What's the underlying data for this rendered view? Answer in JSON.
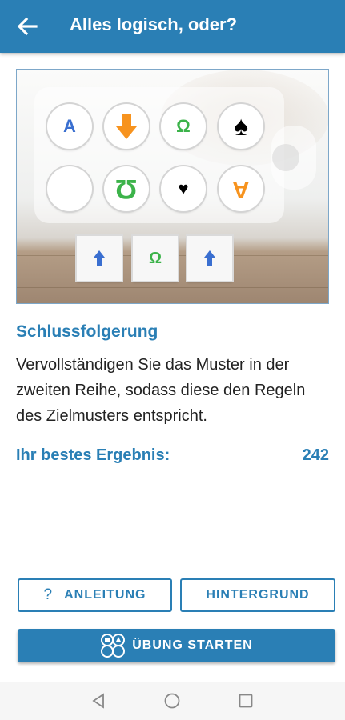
{
  "appbar": {
    "title": "Alles logisch, oder?",
    "back_icon": "arrow-left-icon"
  },
  "puzzle": {
    "row1": [
      {
        "icon": "letter-a",
        "text": "A",
        "color": "#3a6fd0"
      },
      {
        "icon": "arrow-down-icon",
        "text": "",
        "color": "#f7931e"
      },
      {
        "icon": "omega",
        "text": "Ω",
        "color": "#3cb34a"
      },
      {
        "icon": "spade-icon",
        "text": "",
        "color": "#000000"
      }
    ],
    "row2": [
      {
        "icon": "empty",
        "text": "",
        "color": ""
      },
      {
        "icon": "omega-inverted",
        "text": "Ω",
        "color": "#3cb34a"
      },
      {
        "icon": "heart-icon",
        "text": "",
        "color": "#000000"
      },
      {
        "icon": "letter-a-inverted",
        "text": "A",
        "color": "#f7931e"
      }
    ],
    "tiles": [
      {
        "icon": "arrow-up-icon",
        "text": "",
        "color": "#3a6fd0"
      },
      {
        "icon": "omega",
        "text": "Ω",
        "color": "#3cb34a"
      },
      {
        "icon": "arrow-up-icon",
        "text": "",
        "color": "#3a6fd0"
      }
    ]
  },
  "section": {
    "title": "Schlussfolgerung",
    "description": "Vervollständigen Sie das Muster in der zweiten Reihe, sodass diese den Regeln des Zielmusters entspricht."
  },
  "best": {
    "label": "Ihr bestes Ergebnis:",
    "value": "242"
  },
  "buttons": {
    "instructions_icon": "?",
    "instructions": "ANLEITUNG",
    "background": "HINTERGRUND",
    "start": "ÜBUNG STARTEN",
    "start_icon": "shapes-icon"
  },
  "colors": {
    "primary": "#2a7fb5"
  }
}
